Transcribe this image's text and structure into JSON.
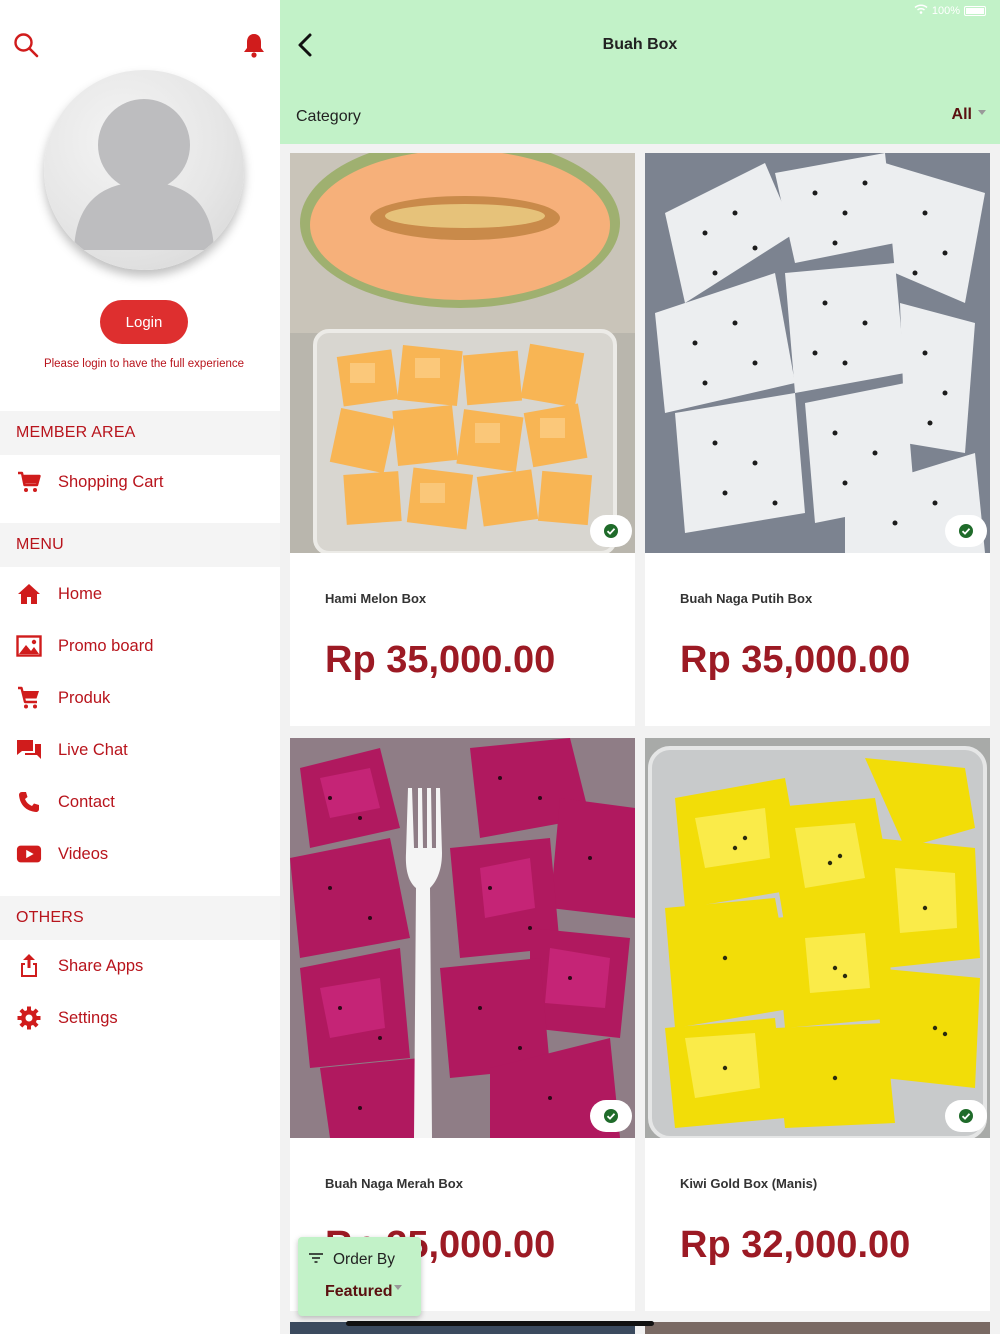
{
  "sidebar": {
    "login_label": "Login",
    "login_hint": "Please login to have the full experience",
    "sections": {
      "member": "MEMBER AREA",
      "menu": "MENU",
      "others": "OTHERS"
    },
    "items": {
      "cart": "Shopping Cart",
      "home": "Home",
      "promo": "Promo board",
      "produk": "Produk",
      "chat": "Live Chat",
      "contact": "Contact",
      "videos": "Videos",
      "share": "Share Apps",
      "settings": "Settings"
    },
    "icons": [
      "search-icon",
      "bell-icon",
      "cart-icon",
      "home-icon",
      "image-icon",
      "cart-icon",
      "chat-icon",
      "phone-icon",
      "youtube-icon",
      "share-icon",
      "gear-icon"
    ]
  },
  "status_bar": {
    "battery": "100%"
  },
  "header": {
    "title": "Buah Box",
    "category_label": "Category",
    "category_value": "All"
  },
  "products": [
    {
      "name": "Hami Melon Box",
      "price": "Rp 35,000.00"
    },
    {
      "name": "Buah Naga Putih Box",
      "price": "Rp 35,000.00"
    },
    {
      "name": "Buah Naga Merah Box",
      "price": "Rp 35,000.00"
    },
    {
      "name": "Kiwi Gold Box (Manis)",
      "price": "Rp 32,000.00"
    }
  ],
  "order": {
    "label": "Order By",
    "value": "Featured"
  },
  "colors": {
    "accent_red": "#b8141c",
    "header_green": "#c2f2c8",
    "price": "#9c1a24",
    "check_green": "#1f6b2a"
  }
}
